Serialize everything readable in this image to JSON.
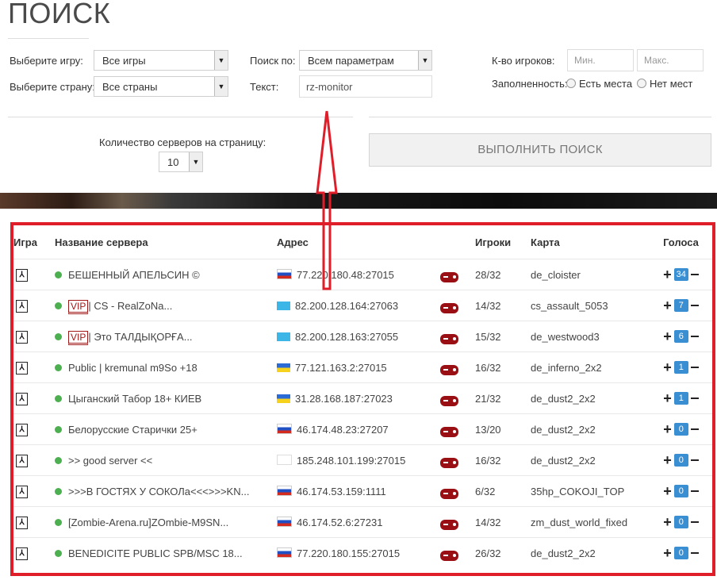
{
  "page": {
    "title": "ПОИСК"
  },
  "filters": {
    "game_label": "Выберите игру:",
    "game_value": "Все игры",
    "country_label": "Выберите страну:",
    "country_value": "Все страны",
    "search_by_label": "Поиск по:",
    "search_by_value": "Всем параметрам",
    "text_label": "Текст:",
    "text_value": "rz-monitor",
    "players_label": "К-во игроков:",
    "min_placeholder": "Мин.",
    "max_placeholder": "Макс.",
    "fill_label": "Заполненность:",
    "fill_opt1": "Есть места",
    "fill_opt2": "Нет мест",
    "per_page_label": "Количество серверов на страницу:",
    "per_page_value": "10",
    "submit_label": "ВЫПОЛНИТЬ ПОИСК"
  },
  "table": {
    "headers": {
      "game": "Игра",
      "name": "Название сервера",
      "address": "Адрес",
      "players": "Игроки",
      "map": "Карта",
      "votes": "Голоса"
    },
    "game_icon": "cs-icon",
    "rows": [
      {
        "vip": false,
        "name": "БЕШЕННЫЙ АПЕЛЬСИН ©",
        "flag": "ru",
        "address": "77.220.180.48:27015",
        "players": "28/32",
        "map": "de_cloister",
        "votes": "34"
      },
      {
        "vip": true,
        "vip_label": "VIP",
        "name": "| CS - RealZoNa...",
        "flag": "kz",
        "address": "82.200.128.164:27063",
        "players": "14/32",
        "map": "cs_assault_5053",
        "votes": "7"
      },
      {
        "vip": true,
        "vip_label": "VIP",
        "name": "| Это ТАЛДЫҚОРҒА...",
        "flag": "kz",
        "address": "82.200.128.163:27055",
        "players": "15/32",
        "map": "de_westwood3",
        "votes": "6"
      },
      {
        "vip": false,
        "name": "Public | kremunal m9So +18",
        "flag": "ua",
        "address": "77.121.163.2:27015",
        "players": "16/32",
        "map": "de_inferno_2x2",
        "votes": "1"
      },
      {
        "vip": false,
        "name": "Цыганский Табор 18+ КИЕВ",
        "flag": "ua",
        "address": "31.28.168.187:27023",
        "players": "21/32",
        "map": "de_dust2_2x2",
        "votes": "1"
      },
      {
        "vip": false,
        "name": "Белорусские Старички 25+",
        "flag": "ru",
        "address": "46.174.48.23:27207",
        "players": "13/20",
        "map": "de_dust2_2x2",
        "votes": "0"
      },
      {
        "vip": false,
        "name": ">> good server <<",
        "flag": "ol",
        "address": "185.248.101.199:27015",
        "players": "16/32",
        "map": "de_dust2_2x2",
        "votes": "0"
      },
      {
        "vip": false,
        "name": ">>>В ГОСТЯХ У СОКОЛа<<<>>>KN...",
        "flag": "ru",
        "address": "46.174.53.159:1111",
        "players": "6/32",
        "map": "35hp_COKOJI_TOP",
        "votes": "0"
      },
      {
        "vip": false,
        "name": "[Zombie-Arena.ru]ZOmbie-M9SN...",
        "flag": "ru",
        "address": "46.174.52.6:27231",
        "players": "14/32",
        "map": "zm_dust_world_fixed",
        "votes": "0"
      },
      {
        "vip": false,
        "name": "BENEDICITE PUBLIC SPB/MSC 18...",
        "flag": "ru",
        "address": "77.220.180.155:27015",
        "players": "26/32",
        "map": "de_dust2_2x2",
        "votes": "0"
      }
    ]
  },
  "colors": {
    "highlight_red": "#e01e2a",
    "online_green": "#4caf50",
    "vote_blue": "#3a8fd3"
  }
}
